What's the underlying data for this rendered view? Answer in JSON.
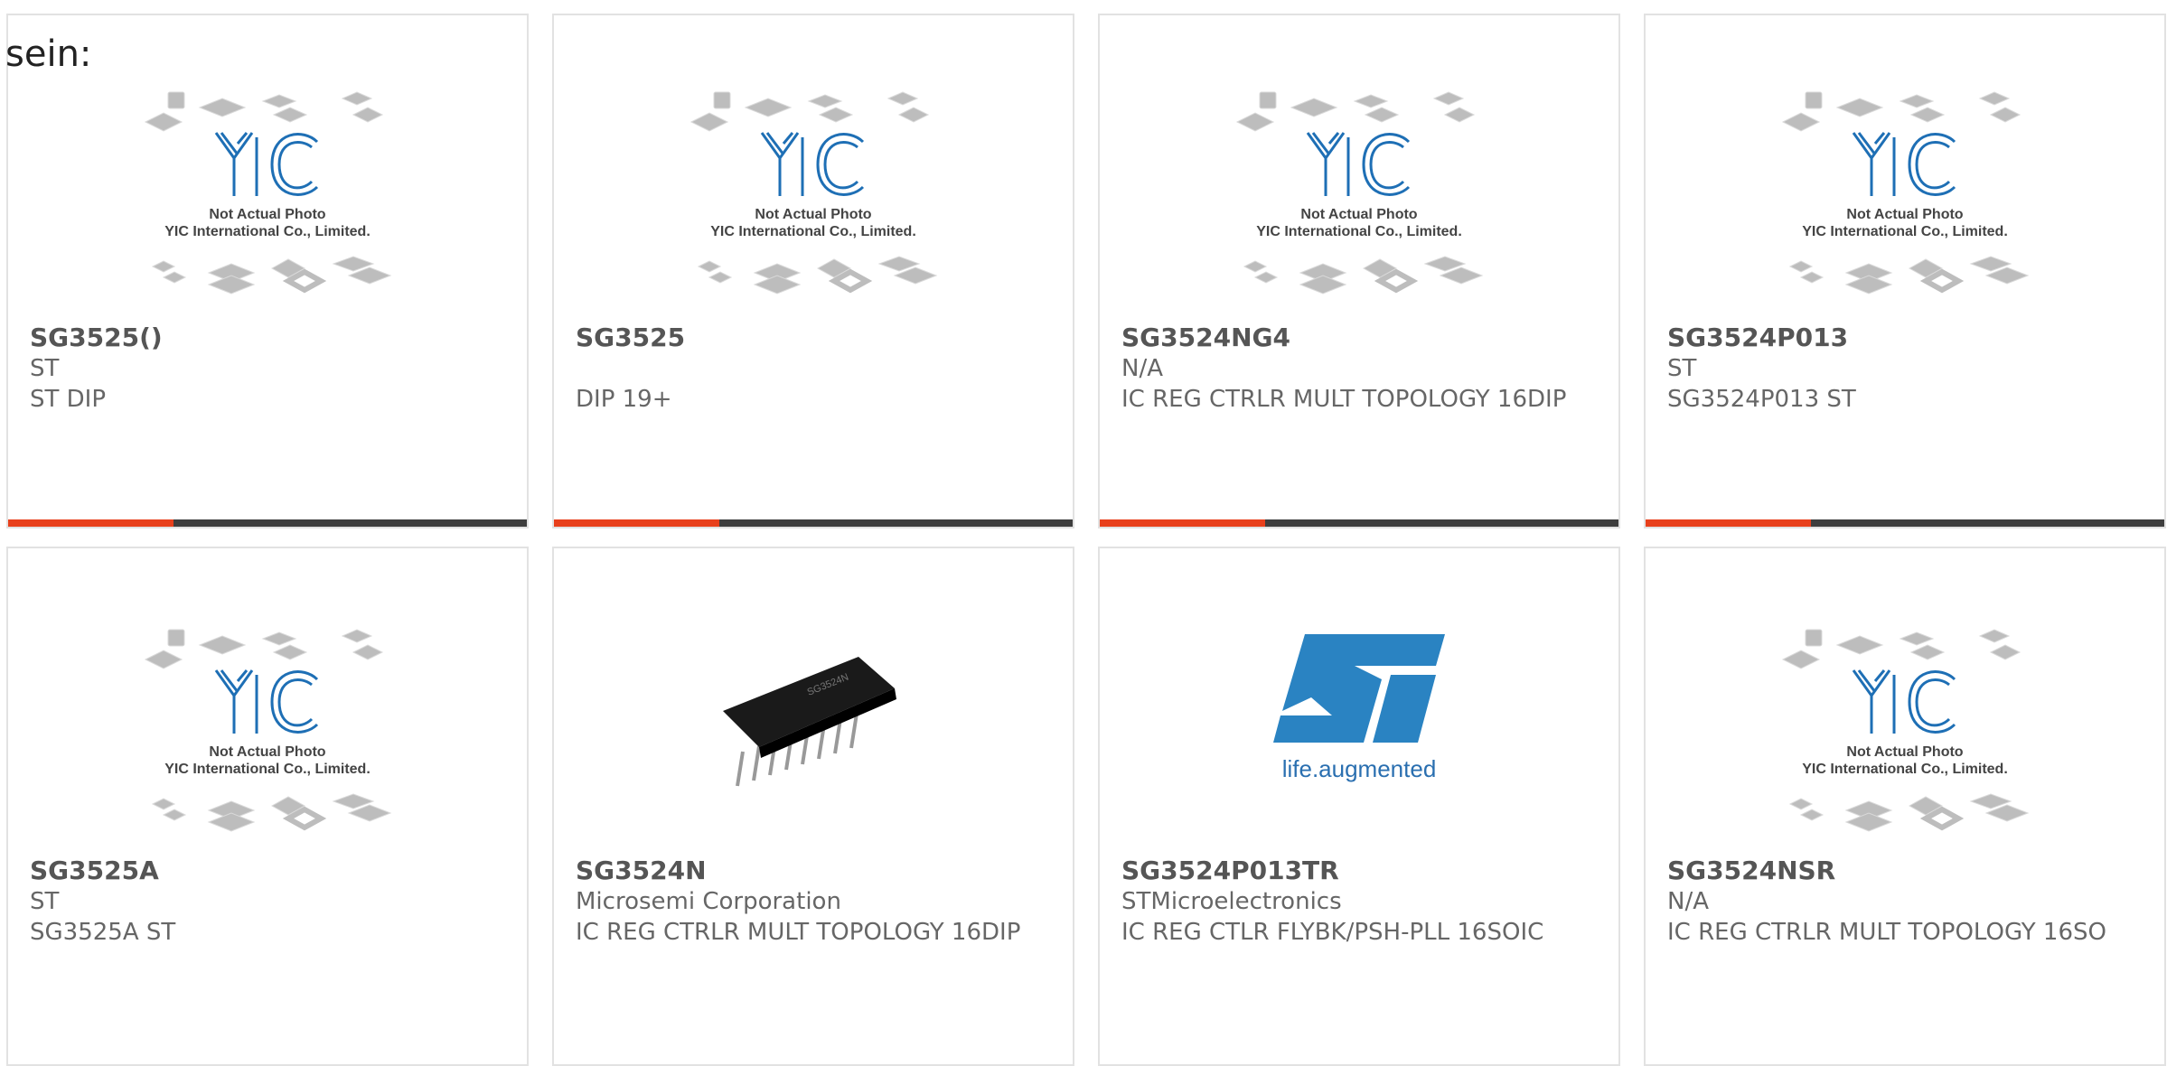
{
  "heading": "sein:",
  "placeholder": {
    "line1": "Not Actual Photo",
    "line2": "YIC International Co., Limited.",
    "logo": "YIC"
  },
  "st_logo_text": "life.augmented",
  "accent_color": "#e8401c",
  "bar_color": "#3e3e3e",
  "cards": [
    {
      "part": "SG3525()",
      "manufacturer": "ST",
      "description": "ST DIP",
      "image": "placeholder-icon"
    },
    {
      "part": "SG3525",
      "manufacturer": "",
      "description": "DIP 19+",
      "image": "placeholder-icon"
    },
    {
      "part": "SG3524NG4",
      "manufacturer": "N/A",
      "description": "IC REG CTRLR MULT TOPOLOGY 16DIP",
      "image": "placeholder-icon"
    },
    {
      "part": "SG3524P013",
      "manufacturer": "ST",
      "description": "SG3524P013 ST",
      "image": "placeholder-icon"
    },
    {
      "part": "SG3525A",
      "manufacturer": "ST",
      "description": "SG3525A ST",
      "image": "placeholder-icon"
    },
    {
      "part": "SG3524N",
      "manufacturer": "Microsemi Corporation",
      "description": "IC REG CTRLR MULT TOPOLOGY 16DIP",
      "image": "dip-chip-photo"
    },
    {
      "part": "SG3524P013TR",
      "manufacturer": "STMicroelectronics",
      "description": "IC REG CTLR FLYBK/PSH-PLL 16SOIC",
      "image": "st-logo"
    },
    {
      "part": "SG3524NSR",
      "manufacturer": "N/A",
      "description": "IC REG CTRLR MULT TOPOLOGY 16SO",
      "image": "placeholder-icon"
    }
  ]
}
